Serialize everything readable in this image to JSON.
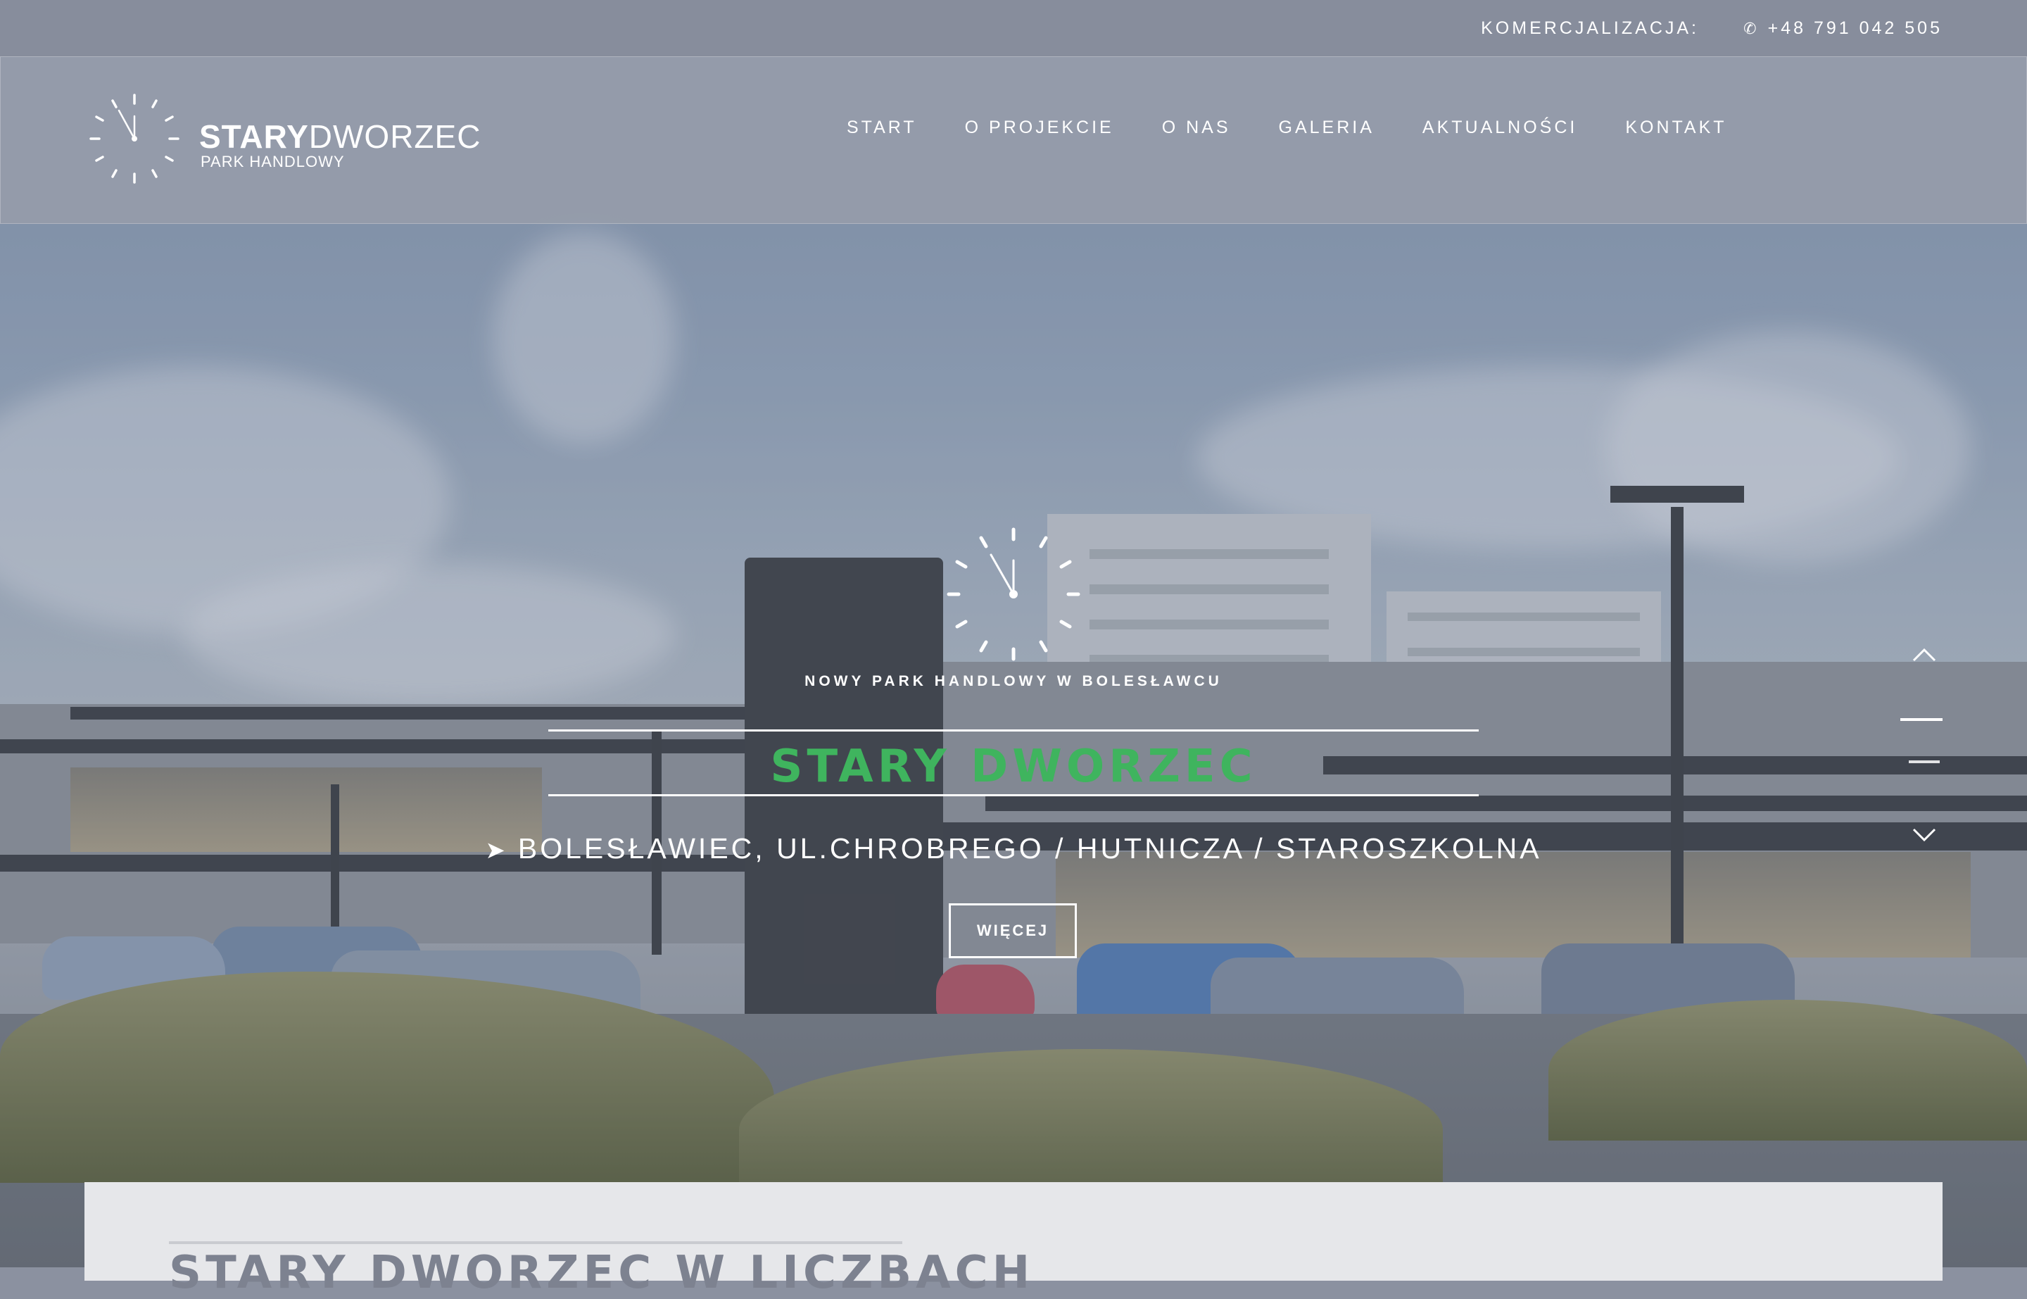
{
  "topbar": {
    "commercial_label": "KOMERCJALIZACJA:",
    "phone": "+48 791 042 505",
    "phone_icon": "phone-icon"
  },
  "logo": {
    "name_bold": "STARY",
    "name_light": "DWORZEC",
    "subtitle": "PARK HANDLOWY",
    "icon": "clock-icon"
  },
  "nav": {
    "items": [
      {
        "label": "START"
      },
      {
        "label": "O PROJEKCIE"
      },
      {
        "label": "O NAS"
      },
      {
        "label": "GALERIA"
      },
      {
        "label": "AKTUALNOŚCI"
      },
      {
        "label": "KONTAKT"
      }
    ]
  },
  "hero": {
    "subtitle": "NOWY PARK HANDLOWY W BOLESŁAWCU",
    "title": "STARY DWORZEC",
    "address": "BOLESŁAWIEC, UL.CHROBREGO / HUTNICZA / STAROSZKOLNA",
    "address_icon": "location-arrow-icon",
    "button_label": "WIĘCEJ",
    "accent_color": "#3fb45e"
  },
  "slider": {
    "up_icon": "chevron-up-icon",
    "down_icon": "chevron-down-icon",
    "active_index": 0,
    "slide_count": 2
  },
  "section": {
    "heading": "STARY DWORZEC W LICZBACH"
  }
}
